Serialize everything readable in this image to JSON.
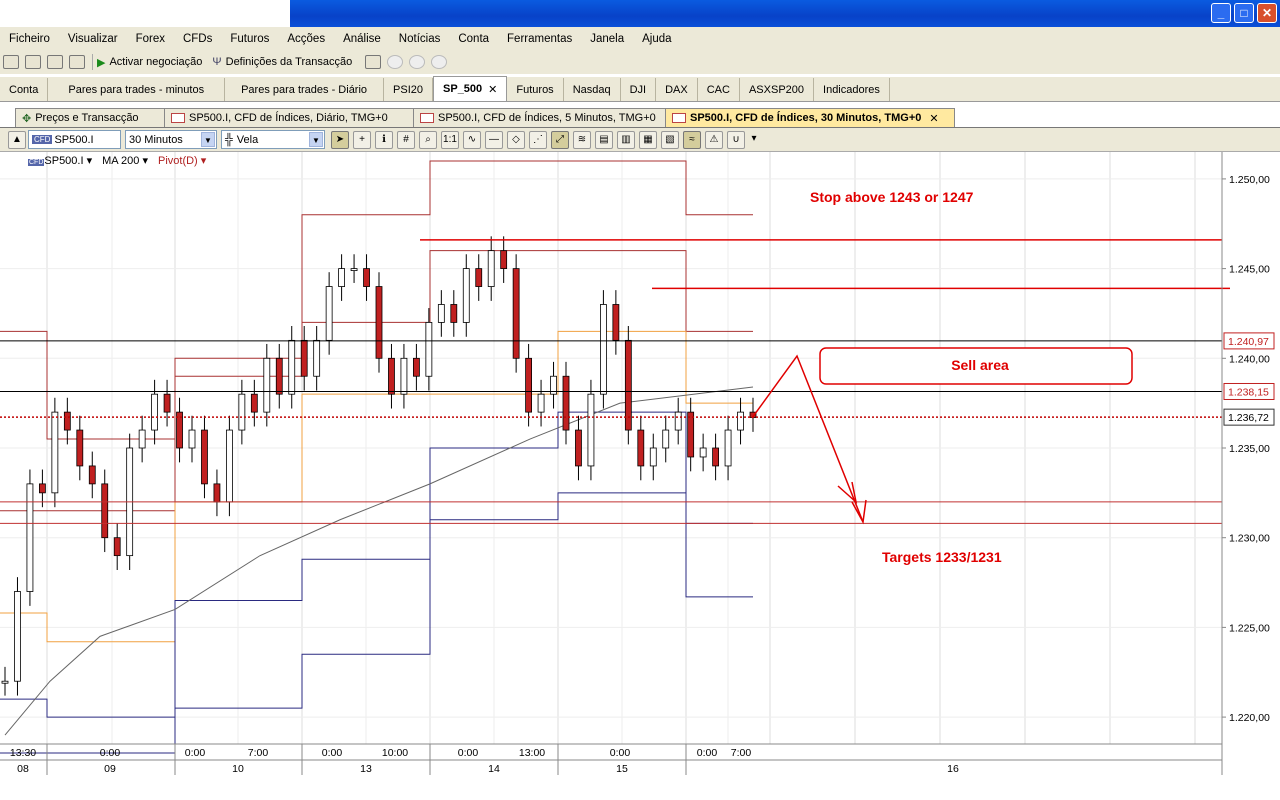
{
  "window": {
    "controls": [
      "_",
      "□",
      "✕"
    ]
  },
  "menu": [
    "Ficheiro",
    "Visualizar",
    "Forex",
    "CFDs",
    "Futuros",
    "Acções",
    "Análise",
    "Notícias",
    "Conta",
    "Ferramentas",
    "Janela",
    "Ajuda"
  ],
  "toolbar": {
    "activate": "Activar negociação",
    "settings": "Definições da Transacção"
  },
  "main_tabs": [
    "Conta",
    "Pares para trades - minutos",
    "Pares para trades - Diário",
    "PSI20",
    "SP_500",
    "Futuros",
    "Nasdaq",
    "DJI",
    "DAX",
    "CAC",
    "ASXSP200",
    "Indicadores"
  ],
  "active_main_tab": "SP_500",
  "chart_tabs": [
    "Preços e Transacção",
    "SP500.I, CFD de Índices, Diário, TMG+0",
    "SP500.I, CFD de Índices, 5 Minutos, TMG+0",
    "SP500.I, CFD de Índices, 30 Minutos, TMG+0"
  ],
  "chart_toolbar": {
    "symbol": "SP500.I",
    "interval": "30 Minutos",
    "chart_type": "Vela"
  },
  "legend": {
    "symbol": "SP500.I",
    "ma": "MA 200",
    "pivot": "Pivot(D)"
  },
  "annotations": {
    "stop": "Stop above 1243 or 1247",
    "sell": "Sell area",
    "targets": "Targets 1233/1231"
  },
  "colors": {
    "annotation": "#e00000",
    "pivot_red": "#a02020",
    "pivot_blue": "#1a1a7a",
    "pivot_orange": "#f0a040",
    "menu_bg": "#ece9d8"
  },
  "chart_data": {
    "type": "line",
    "ylim": [
      1218.5,
      1251.5
    ],
    "yticks": [
      1220,
      1225,
      1230,
      1235,
      1240,
      1245,
      1250
    ],
    "ytick_labels": [
      "1.220,00",
      "1.225,00",
      "1.230,00",
      "1.235,00",
      "1.240,00",
      "1.245,00",
      "1.250,00"
    ],
    "price_markers": [
      {
        "value": 1240.97,
        "label": "1.240,97"
      },
      {
        "value": 1238.15,
        "label": "1.238,15"
      },
      {
        "value": 1236.72,
        "label": "1.236,72"
      }
    ],
    "hlines": [
      1246.6,
      1243.9,
      1232.0,
      1230.8
    ],
    "time_labels": [
      "13:30",
      "0:00",
      "0:00",
      "7:00",
      "0:00",
      "10:00",
      "0:00",
      "13:00",
      "0:00",
      "0:00",
      "7:00"
    ],
    "date_labels": [
      "08",
      "09",
      "10",
      "13",
      "14",
      "15",
      "16"
    ],
    "pivot_levels": [
      {
        "name": "R2",
        "color": "red",
        "values": [
          1241.5,
          1235.5,
          1240,
          1248,
          1251,
          1251,
          1248
        ]
      },
      {
        "name": "R1",
        "color": "red",
        "values": [
          1231.5,
          1231.5,
          1239,
          1242,
          1246,
          1246,
          1241.5
        ]
      },
      {
        "name": "P",
        "color": "orange",
        "values": [
          1225.8,
          1224.2,
          1232,
          1238,
          1238,
          1241.5,
          1237.5
        ]
      },
      {
        "name": "S1",
        "color": "blue",
        "values": [
          1221,
          1220,
          1226.5,
          1228.8,
          1235,
          1237,
          1230.8
        ]
      },
      {
        "name": "S2",
        "color": "blue",
        "values": [
          1218,
          1218,
          1220.5,
          1223.5,
          1231,
          1232.5,
          1226.7
        ]
      }
    ],
    "close_path": [
      1222,
      1227,
      1233,
      1232.5,
      1237,
      1236,
      1234,
      1233,
      1230,
      1229,
      1235,
      1236,
      1238,
      1237,
      1235,
      1236,
      1233,
      1232,
      1236,
      1238,
      1237,
      1240,
      1238,
      1241,
      1239,
      1241,
      1244,
      1245,
      1245,
      1244,
      1240,
      1238,
      1240,
      1239,
      1242,
      1243,
      1242,
      1245,
      1244,
      1246,
      1245,
      1240,
      1237,
      1238,
      1239,
      1236,
      1234,
      1238,
      1243,
      1241,
      1236,
      1234,
      1235,
      1236,
      1237,
      1234.5,
      1235,
      1234,
      1236,
      1237,
      1236.7
    ],
    "ma200": [
      1219,
      1222,
      1224.5,
      1226,
      1229,
      1231,
      1233,
      1235.5,
      1237.5,
      1238.4
    ]
  }
}
